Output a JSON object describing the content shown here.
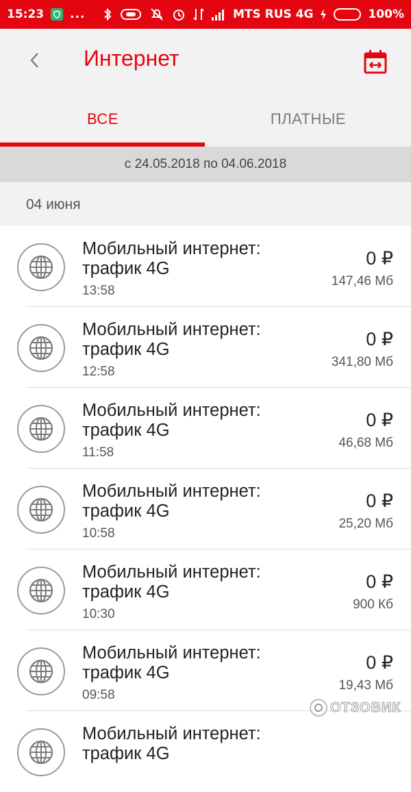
{
  "status_bar": {
    "time": "15:23",
    "dots": "...",
    "carrier": "MTS RUS 4G",
    "battery_percent": "100%",
    "battery_level": 1.0
  },
  "header": {
    "title": "Интернет",
    "back_icon": "chevron-left-icon",
    "calendar_icon": "calendar-icon"
  },
  "tabs": [
    {
      "label": "ВСЕ",
      "active": true
    },
    {
      "label": "ПЛАТНЫЕ",
      "active": false
    }
  ],
  "period": "с 24.05.2018 по 04.06.2018",
  "date_group": "04 июня",
  "items": [
    {
      "title": "Мобильный интернет: трафик 4G",
      "time": "13:58",
      "amount": "0 ₽",
      "volume": "147,46 Мб"
    },
    {
      "title": "Мобильный интернет: трафик 4G",
      "time": "12:58",
      "amount": "0 ₽",
      "volume": "341,80 Мб"
    },
    {
      "title": "Мобильный интернет: трафик 4G",
      "time": "11:58",
      "amount": "0 ₽",
      "volume": "46,68 Мб"
    },
    {
      "title": "Мобильный интернет: трафик 4G",
      "time": "10:58",
      "amount": "0 ₽",
      "volume": "25,20 Мб"
    },
    {
      "title": "Мобильный интернет: трафик 4G",
      "time": "10:30",
      "amount": "0 ₽",
      "volume": "900 Кб"
    },
    {
      "title": "Мобильный интернет: трафик 4G",
      "time": "09:58",
      "amount": "0 ₽",
      "volume": "19,43 Мб"
    },
    {
      "title": "Мобильный интернет: трафик 4G",
      "time": "",
      "amount": "",
      "volume": ""
    }
  ],
  "watermark": "ОТЗОВИК",
  "colors": {
    "accent": "#e30611",
    "appbar_bg": "#f2f2f2",
    "period_bg": "#d9d9d9"
  }
}
